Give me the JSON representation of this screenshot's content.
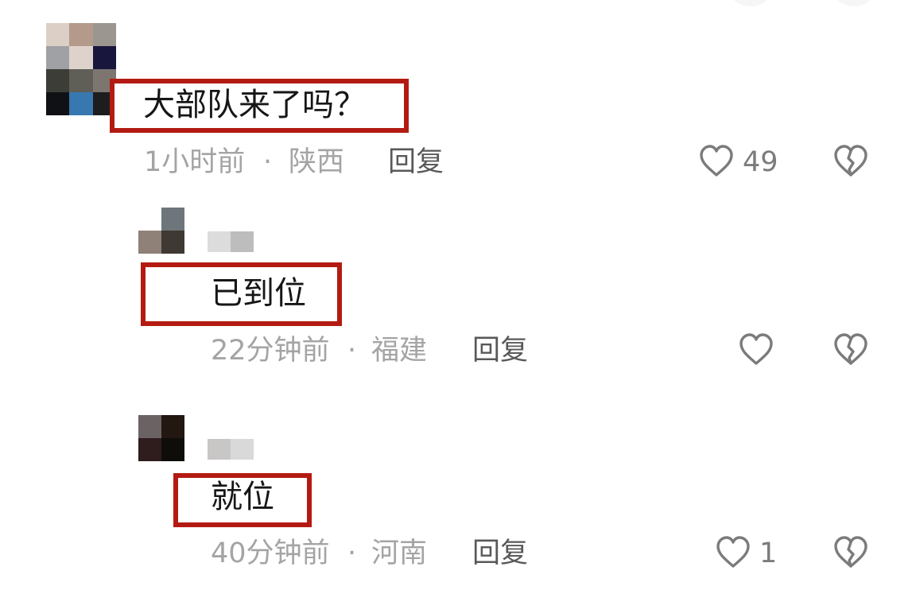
{
  "comments": [
    {
      "text": "大部队来了吗？",
      "time": "1小时前",
      "separator": "·",
      "location": "陕西",
      "reply_label": "回复",
      "like_count": "49",
      "avatar_pixels": [
        "#dccfc5",
        "#b39a8b",
        "#9b9790",
        "#9fa1a5",
        "#ded3cc",
        "#19163d",
        "#3d3d38",
        "#5f5f57",
        "#7d7670",
        "#0f1114",
        "#3778b0",
        "#1d1d1f"
      ],
      "name_pixels": []
    },
    {
      "text": "已到位",
      "time": "22分钟前",
      "separator": "·",
      "location": "福建",
      "reply_label": "回复",
      "like_count": "",
      "avatar_pixels": [
        "#ffffff",
        "#6e767c",
        "#8f8078",
        "#3e3932"
      ],
      "name_pixels": [
        "#dcdcdc",
        "#bdbdbd"
      ]
    },
    {
      "text": "就位",
      "time": "40分钟前",
      "separator": "·",
      "location": "河南",
      "reply_label": "回复",
      "like_count": "1",
      "avatar_pixels": [
        "#6b6264",
        "#231712",
        "#2f1c1d",
        "#0f0d0a"
      ],
      "name_pixels": [
        "#c9c6c6",
        "#d9d9d9"
      ]
    }
  ],
  "icons": {
    "like": "heart-outline-icon",
    "dislike": "broken-heart-icon"
  },
  "colors": {
    "highlight_border": "#b31b12",
    "meta_text": "#a4a4a4",
    "reply_text": "#595959",
    "icon_stroke": "#7b7b7b"
  }
}
